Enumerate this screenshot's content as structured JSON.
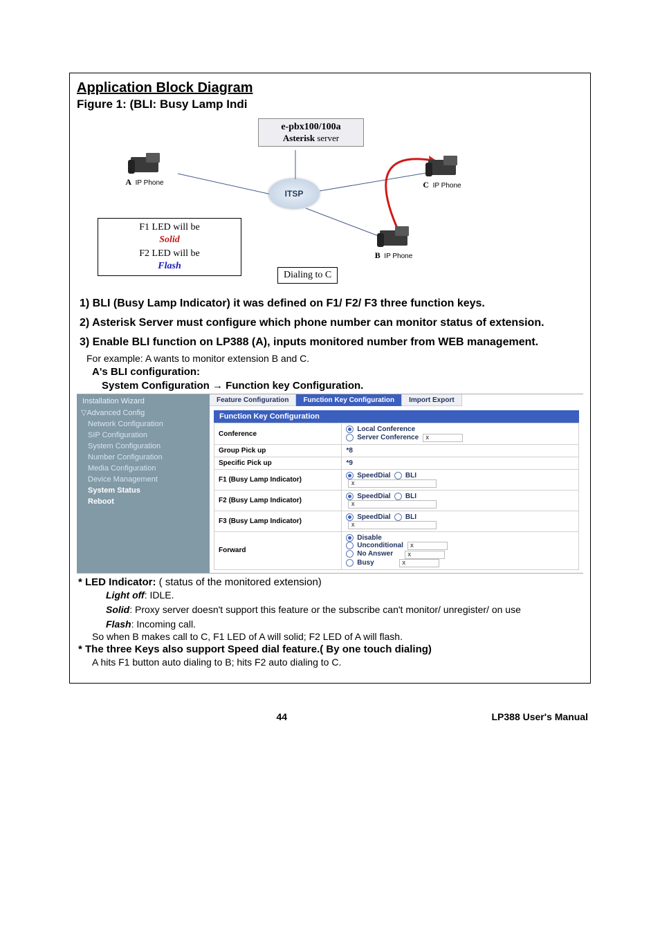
{
  "header": {
    "title": "Application Block Diagram",
    "figure": "Figure 1: (BLI: Busy Lamp Indi"
  },
  "diagram": {
    "pbx_line1": "e-pbx100/100a",
    "pbx_line2a": "Asterisk",
    "pbx_line2b": " server",
    "itsp": "ITSP",
    "phone_a_prefix": "A",
    "phone_a_label": "IP Phone",
    "phone_b_prefix": "B",
    "phone_b_label": "IP Phone",
    "phone_c_prefix": "C",
    "phone_c_label": "IP Phone",
    "led_f1_pre": "F1 LED will be ",
    "led_f1_word": "Solid",
    "led_f2_pre": "F2 LED will be ",
    "led_f2_word": "Flash",
    "dial": "Dialing to C"
  },
  "body": {
    "li1": "1) BLI (Busy Lamp Indicator) it was defined on F1/ F2/ F3 three function keys.",
    "li2": "2) Asterisk Server must configure which phone number can monitor status of extension.",
    "li3": "3) Enable BLI function on LP388 (A), inputs monitored number from WEB management.",
    "example": "For example: A wants to monitor extension B and C.",
    "bli_conf": "A's BLI configuration:",
    "sys_conf": "System Configuration → Function key Configuration."
  },
  "ui": {
    "side": {
      "install": "Installation Wizard",
      "advanced": "Advanced Config",
      "items": [
        "Network Configuration",
        "SIP Configuration",
        "System Configuration",
        "Number Configuration",
        "Media Configuration",
        "Device Management",
        "System Status",
        "Reboot"
      ]
    },
    "tabs": {
      "feature": "Feature Configuration",
      "funckey": "Function Key Configuration",
      "impexp": "Import Export"
    },
    "subhead": "Function Key Configuration",
    "rows": {
      "conference": {
        "label": "Conference",
        "opt1": "Local Conference",
        "opt2": "Server Conference"
      },
      "group_pickup": {
        "label": "Group Pick up",
        "value": "*8"
      },
      "specific_pickup": {
        "label": "Specific Pick up",
        "value": "*9"
      },
      "f1": {
        "label": "F1 (Busy Lamp Indicator)",
        "sd": "SpeedDial",
        "bli": "BLI"
      },
      "f2": {
        "label": "F2 (Busy Lamp Indicator)",
        "sd": "SpeedDial",
        "bli": "BLI"
      },
      "f3": {
        "label": "F3 (Busy Lamp Indicator)",
        "sd": "SpeedDial",
        "bli": "BLI"
      },
      "forward": {
        "label": "Forward",
        "disable": "Disable",
        "uncond": "Unconditional",
        "noans": "No Answer",
        "busy": "Busy"
      }
    }
  },
  "post": {
    "led_head": "* LED Indicator:",
    "led_tail": " ( status of the monitored extension)",
    "lightoff_k": "Light off",
    "lightoff_v": ": IDLE.",
    "solid_k": "Solid",
    "solid_v": ": Proxy server doesn't support this feature or the subscribe can't monitor/ unregister/ on use",
    "flash_k": "Flash",
    "flash_v": ": Incoming call.",
    "so_line": "So when B makes call to C, F1 LED of A will solid; F2 LED of A will flash.",
    "keys_line": "* The three Keys also support Speed dial feature.( By one touch dialing)",
    "hits_line": "A hits F1 button auto dialing to B; hits F2 auto dialing to C."
  },
  "footer": {
    "page": "44",
    "doc": "LP388  User's Manual"
  }
}
